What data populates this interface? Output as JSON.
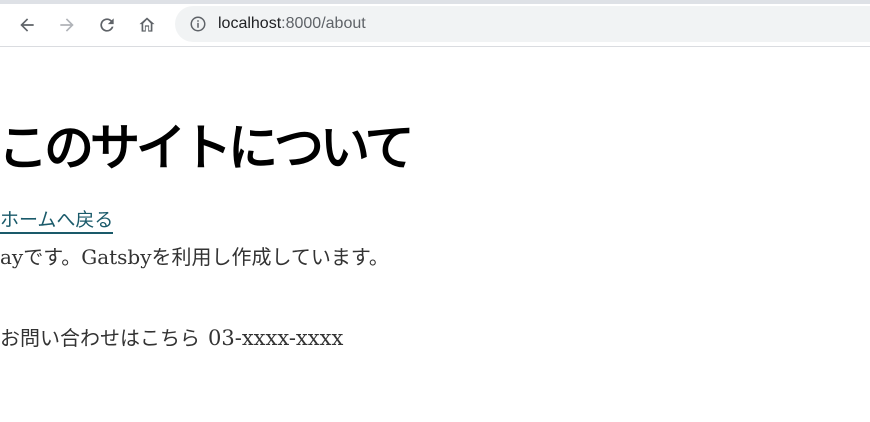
{
  "browser": {
    "url_host": "localhost",
    "url_path": ":8000/about",
    "icons": {
      "back": "arrow-left-icon",
      "forward": "arrow-right-icon",
      "reload": "reload-icon",
      "home": "home-icon",
      "info": "info-icon"
    }
  },
  "page": {
    "title": "このサイトについて",
    "home_link": "ホームへ戻る",
    "intro": "ayです。Gatsbyを利用し作成しています。",
    "contact_label": "お問い合わせはこちら",
    "contact_phone": "03-xxxx-xxxx"
  },
  "colors": {
    "link": "#1a5a6a",
    "text": "#333333",
    "title": "#000000"
  }
}
